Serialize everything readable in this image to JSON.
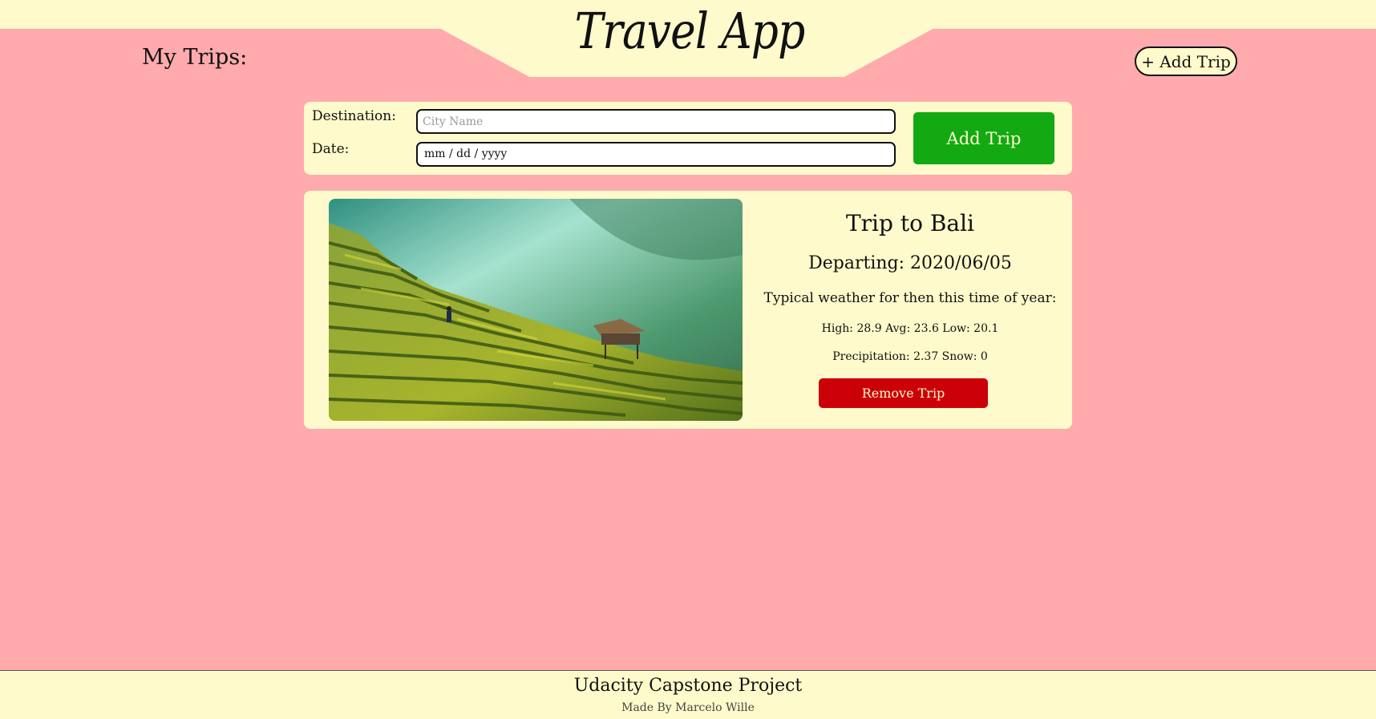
{
  "header": {
    "app_title": "Travel App",
    "my_trips_label": "My Trips:",
    "add_trip_toggle_label": "+ Add Trip"
  },
  "form": {
    "destination_label": "Destination:",
    "destination_placeholder": "City Name",
    "destination_value": "",
    "date_label": "Date:",
    "date_placeholder": "mm / dd / yyyy",
    "submit_label": "Add Trip"
  },
  "trips": [
    {
      "title": "Trip to Bali",
      "departing": "Departing: 2020/06/05",
      "weather_heading": "Typical weather for then this time of year:",
      "temperatures": "High: 28.9 Avg: 23.6 Low: 20.1",
      "precipitation": "Precipitation: 2.37 Snow: 0",
      "remove_label": "Remove Trip",
      "image_icon": "rice-terrace-photo"
    }
  ],
  "footer": {
    "title": "Udacity Capstone Project",
    "subtitle": "Made By Marcelo Wille"
  },
  "colors": {
    "page_background": "#ffaaad",
    "panel_background": "#fffacb",
    "add_button": "#12a912",
    "remove_button": "#cc0008"
  }
}
